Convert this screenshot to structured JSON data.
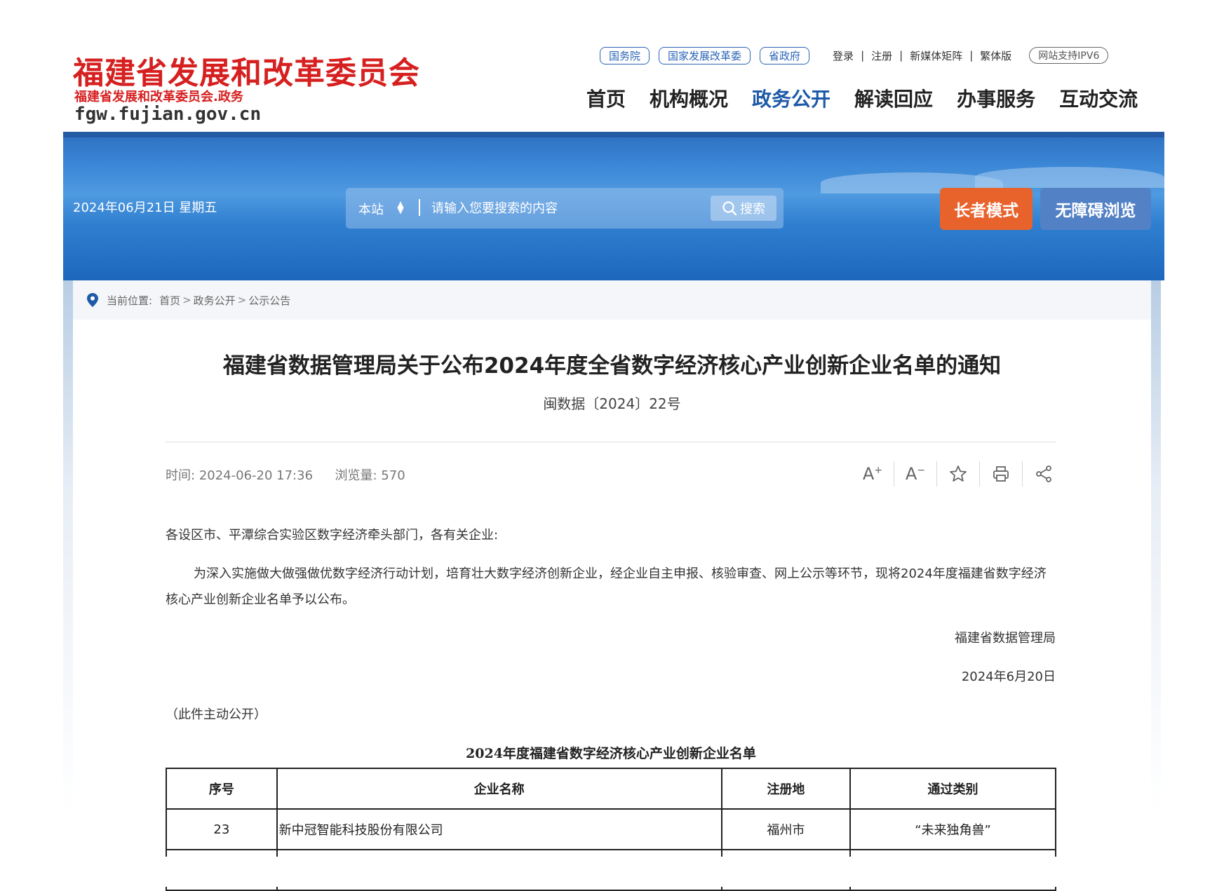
{
  "header": {
    "logo_title": "福建省发展和改革委员会",
    "logo_subtitle": "福建省发展和改革委员会.政务",
    "logo_domain": "fgw.fujian.gov.cn",
    "top_links": [
      "国务院",
      "国家发展改革委",
      "省政府"
    ],
    "util_links": [
      "登录",
      "注册",
      "新媒体矩阵",
      "繁体版"
    ],
    "ipv6_badge": "网站支持IPV6",
    "nav": [
      "首页",
      "机构概况",
      "政务公开",
      "解读回应",
      "办事服务",
      "互动交流"
    ],
    "active_nav": "政务公开"
  },
  "banner": {
    "date": "2024年06月21日 星期五",
    "search_scope": "本站",
    "search_placeholder": "请输入您要搜索的内容",
    "search_button": "搜索",
    "elder_mode": "长者模式",
    "accessible": "无障碍浏览"
  },
  "breadcrumb": {
    "label": "当前位置:",
    "items": [
      "首页",
      "政务公开",
      "公示公告"
    ]
  },
  "article": {
    "title": "福建省数据管理局关于公布2024年度全省数字经济核心产业创新企业名单的通知",
    "doc_number": "闽数据〔2024〕22号",
    "time_label": "时间:",
    "time": "2024-06-20 17:36",
    "views_label": "浏览量:",
    "views": "570",
    "salutation": "各设区市、平潭综合实验区数字经济牵头部门，各有关企业:",
    "paragraph": "为深入实施做大做强做优数字经济行动计划，培育壮大数字经济创新企业，经企业自主申报、核验审查、网上公示等环节，现将2024年度福建省数字经济核心产业创新企业名单予以公布。",
    "sign_org": "福建省数据管理局",
    "sign_date": "2024年6月20日",
    "public_note": "（此件主动公开）",
    "table_title": "2024年度福建省数字经济核心产业创新企业名单",
    "table_headers": [
      "序号",
      "企业名称",
      "注册地",
      "通过类别"
    ],
    "table_rows": [
      [
        "23",
        "新中冠智能科技股份有限公司",
        "福州市",
        "“未来独角兽”"
      ]
    ]
  },
  "tools": {
    "font_increase": "A",
    "font_decrease": "A"
  },
  "colors": {
    "brand_red": "#d62020",
    "nav_active": "#1e5aa8",
    "elder_orange": "#e8622c",
    "access_blue": "#5381c6"
  }
}
